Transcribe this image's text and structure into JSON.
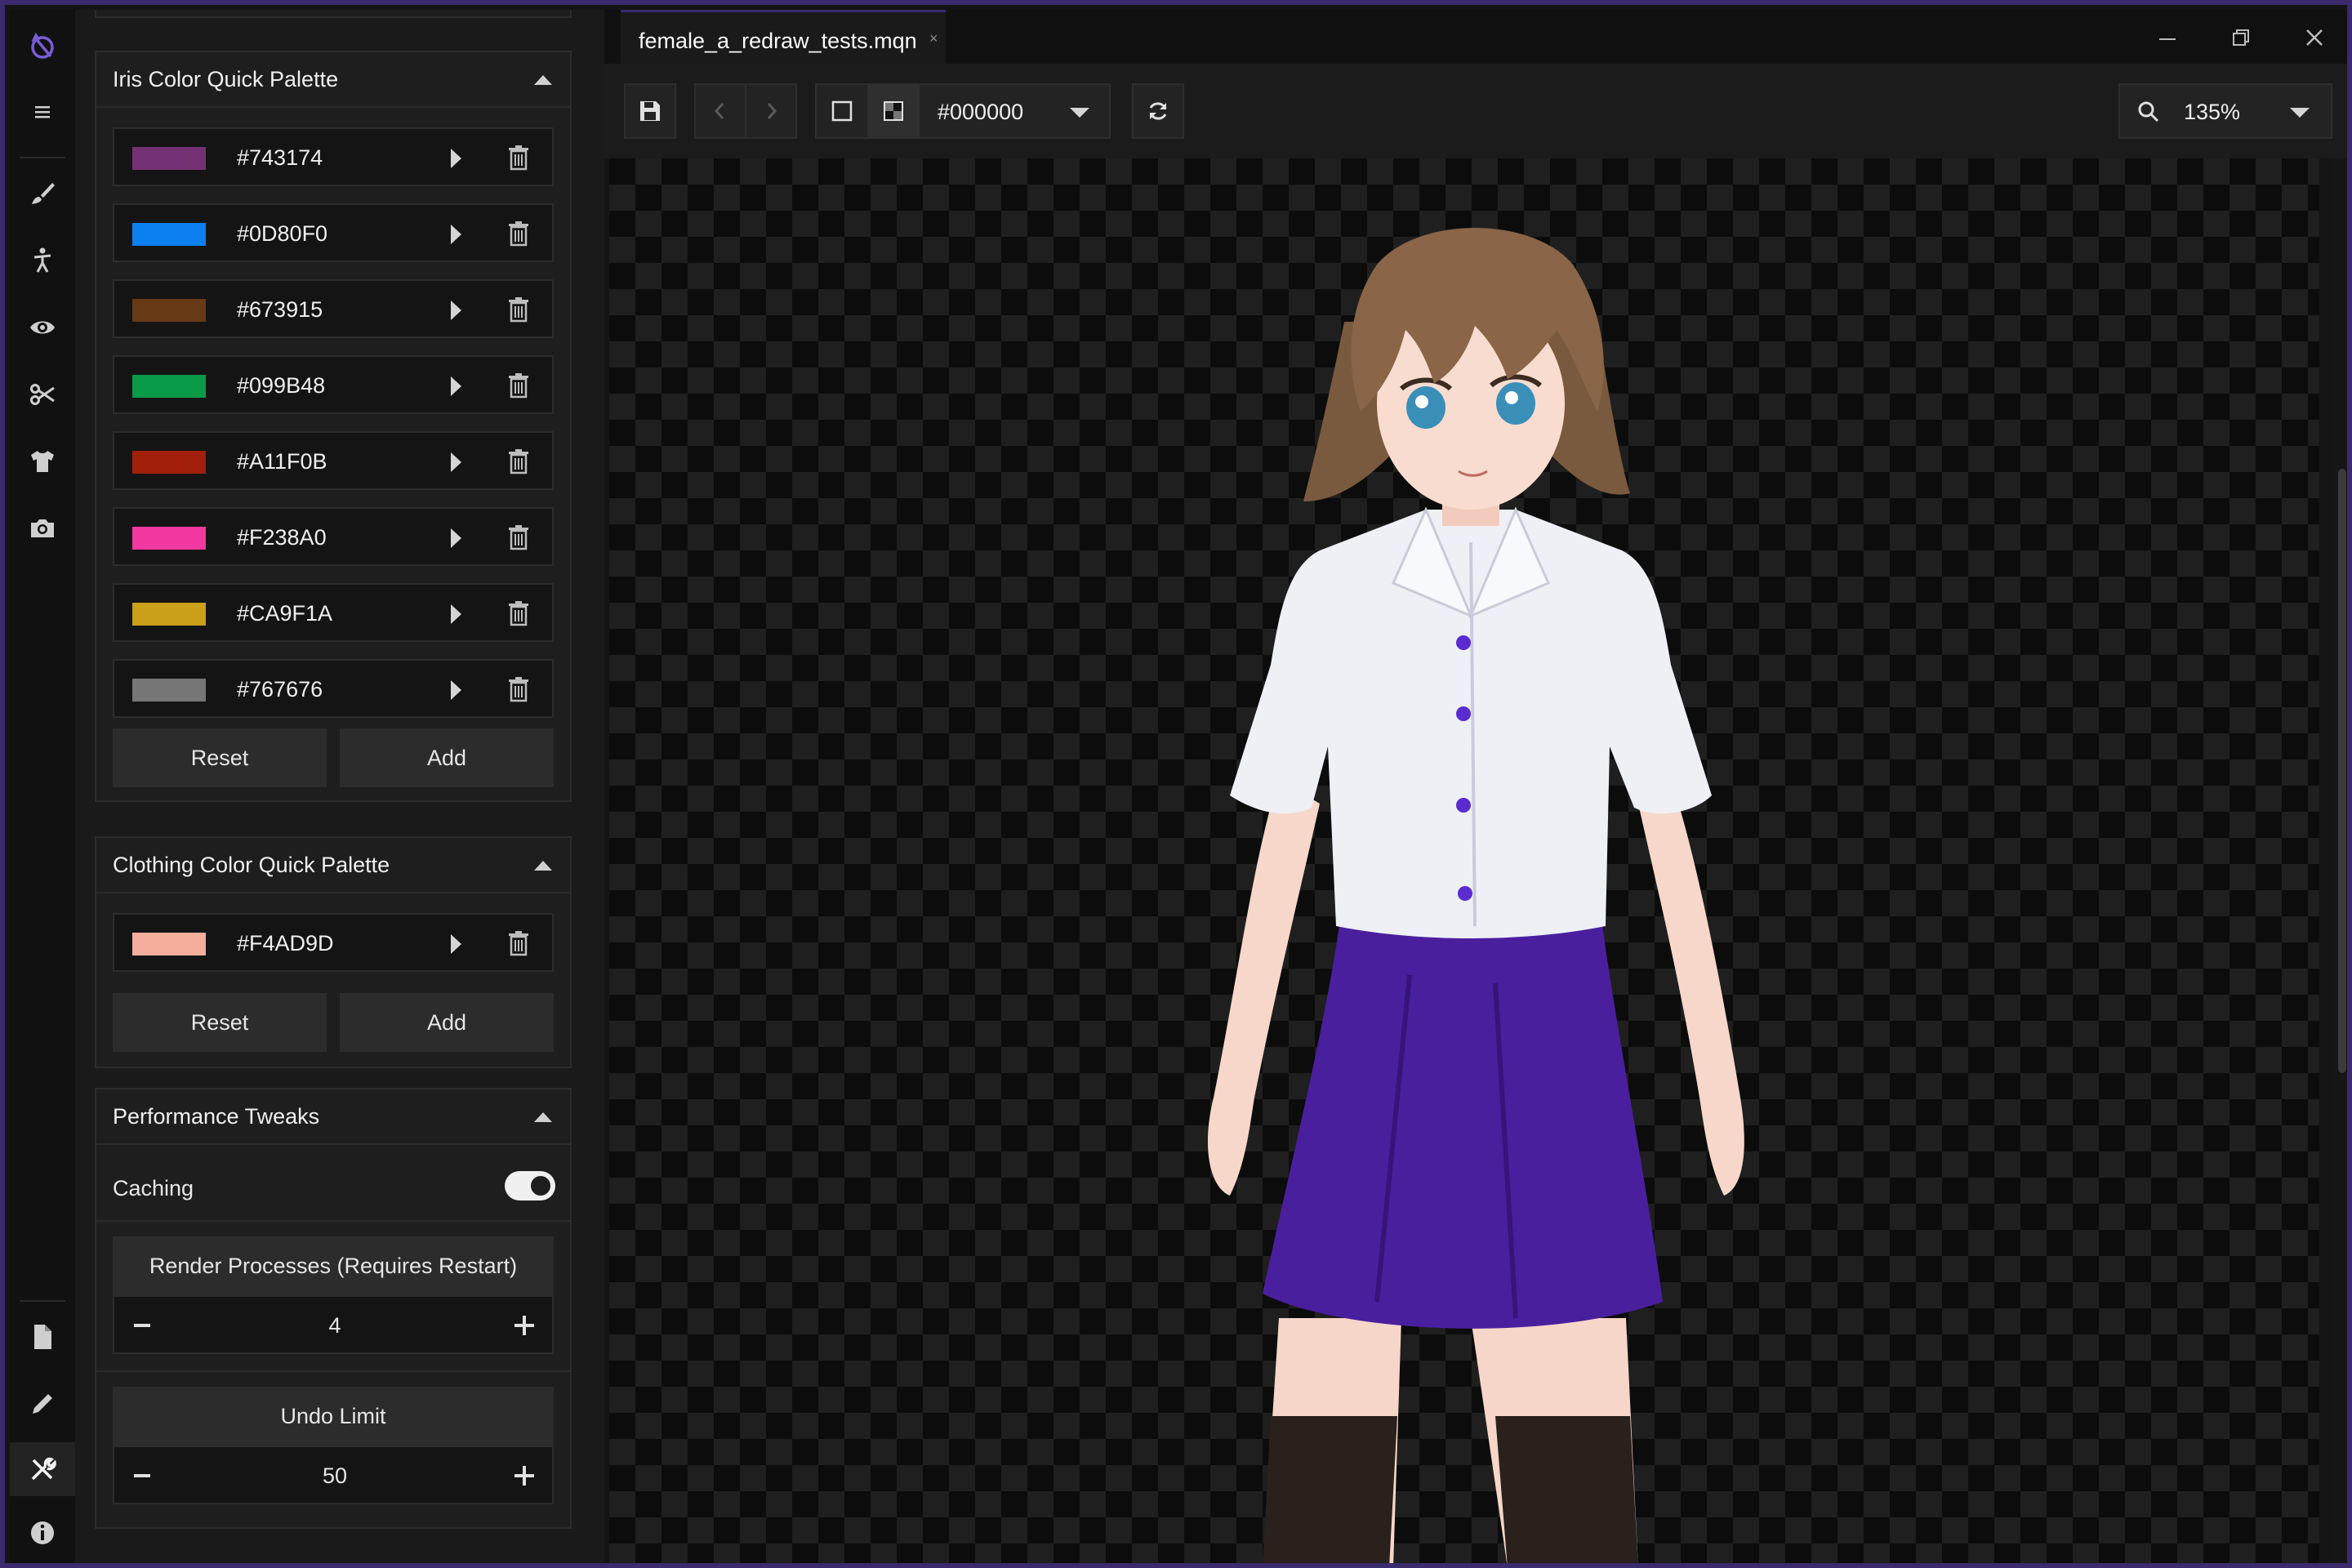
{
  "window": {
    "tab_title": "female_a_redraw_tests.mqn",
    "tab_close": "×",
    "accent_color": "#3a2a6e"
  },
  "rail": {
    "icons": [
      "app-logo-icon",
      "hamburger-menu-icon",
      "brush-icon",
      "figure-pose-icon",
      "eye-icon",
      "scissors-icon",
      "shirt-icon",
      "camera-icon",
      "document-icon",
      "pencil-icon",
      "wrench-tools-icon",
      "info-icon"
    ],
    "active": "wrench-tools-icon"
  },
  "iris_palette": {
    "title": "Iris Color Quick Palette",
    "colors": [
      {
        "hex": "#743174",
        "swatch": "#743174"
      },
      {
        "hex": "#0D80F0",
        "swatch": "#0D80F0"
      },
      {
        "hex": "#673915",
        "swatch": "#673915"
      },
      {
        "hex": "#099B48",
        "swatch": "#099B48"
      },
      {
        "hex": "#A11F0B",
        "swatch": "#A11F0B"
      },
      {
        "hex": "#F238A0",
        "swatch": "#F238A0"
      },
      {
        "hex": "#CA9F1A",
        "swatch": "#CA9F1A"
      },
      {
        "hex": "#767676",
        "swatch": "#767676"
      }
    ],
    "reset_label": "Reset",
    "add_label": "Add"
  },
  "clothing_palette": {
    "title": "Clothing Color Quick Palette",
    "colors": [
      {
        "hex": "#F4AD9D",
        "swatch": "#F4AD9D"
      }
    ],
    "reset_label": "Reset",
    "add_label": "Add"
  },
  "performance": {
    "title": "Performance Tweaks",
    "caching_label": "Caching",
    "caching_enabled": true,
    "render_processes_label": "Render Processes (Requires Restart)",
    "render_processes_value": "4",
    "undo_limit_label": "Undo Limit",
    "undo_limit_value": "50"
  },
  "toolbar": {
    "background_color_value": "#000000",
    "zoom_value": "135%"
  },
  "canvas": {
    "character": {
      "hair_color": "#8a6548",
      "shirt_color": "#eef0f6",
      "skirt_color": "#4a1f9e",
      "button_color": "#5a2bd0",
      "skin_color": "#f8d9cc",
      "stocking_color": "#2a201c",
      "eye_color": "#3a8fb8"
    }
  }
}
